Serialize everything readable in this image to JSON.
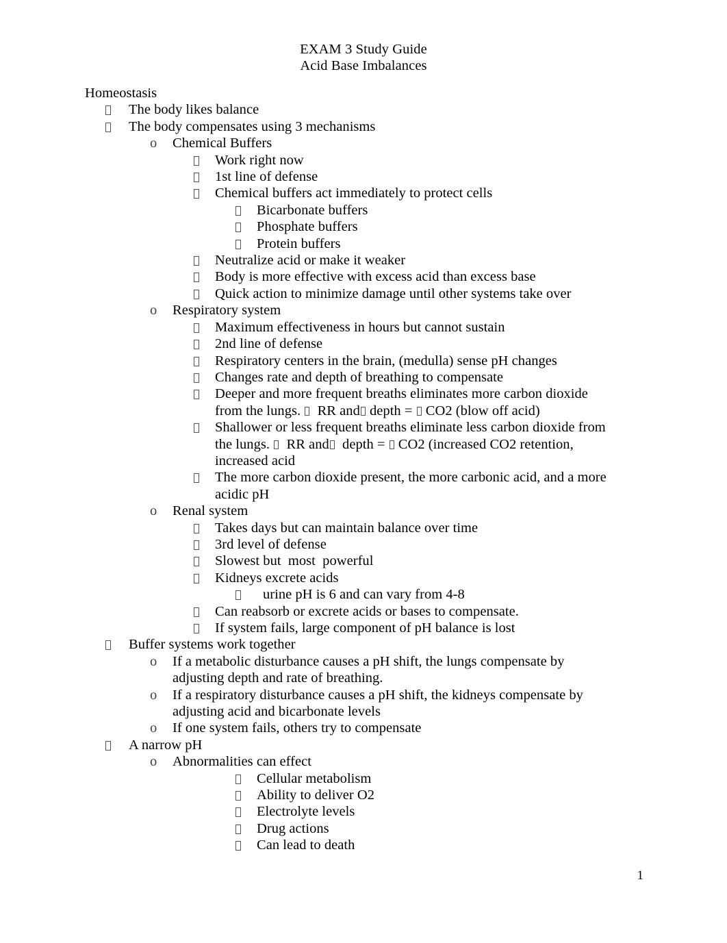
{
  "document": {
    "title_line_1": "EXAM 3 Study Guide",
    "title_line_2": "Acid Base Imbalances",
    "page_number": "1"
  },
  "outline": [
    {
      "level": 0,
      "marker": "none",
      "text": "Homeostasis"
    },
    {
      "level": 1,
      "marker": "tofu",
      "text": "The body likes balance"
    },
    {
      "level": 1,
      "marker": "tofu",
      "text": "The body compensates using 3 mechanisms"
    },
    {
      "level": 2,
      "marker": "o",
      "text": "Chemical Buffers"
    },
    {
      "level": 3,
      "marker": "tofu",
      "text": "Work right now"
    },
    {
      "level": 3,
      "marker": "tofu",
      "text": "1st line of defense"
    },
    {
      "level": 3,
      "marker": "tofu",
      "text": "Chemical buffers act immediately to protect cells"
    },
    {
      "level": 4,
      "marker": "tofu",
      "text": "Bicarbonate buffers"
    },
    {
      "level": 4,
      "marker": "tofu",
      "text": "Phosphate buffers"
    },
    {
      "level": 4,
      "marker": "tofu",
      "text": "Protein buffers"
    },
    {
      "level": 3,
      "marker": "tofu",
      "text": "Neutralize acid or make it weaker"
    },
    {
      "level": 3,
      "marker": "tofu",
      "text": "Body is more effective with excess acid than excess base"
    },
    {
      "level": 3,
      "marker": "tofu",
      "text": "Quick action to minimize damage until other systems take over"
    },
    {
      "level": 2,
      "marker": "o",
      "text": "Respiratory system"
    },
    {
      "level": 3,
      "marker": "tofu",
      "text": "Maximum effectiveness in hours but cannot sustain"
    },
    {
      "level": 3,
      "marker": "tofu",
      "text": "2nd line of defense"
    },
    {
      "level": 3,
      "marker": "tofu",
      "text": "Respiratory centers in the brain, (medulla) sense pH changes"
    },
    {
      "level": 3,
      "marker": "tofu",
      "text": "Changes rate and depth of breathing to compensate"
    },
    {
      "level": 3,
      "marker": "tofu",
      "segments": [
        {
          "type": "text",
          "value": "Deeper and more frequent breaths eliminates more carbon dioxide from the lungs. "
        },
        {
          "type": "glyph",
          "value": "tofu"
        },
        {
          "type": "text",
          "value": "  RR and"
        },
        {
          "type": "glyph",
          "value": "tofu"
        },
        {
          "type": "text",
          "value": " depth = "
        },
        {
          "type": "glyph",
          "value": "tofu"
        },
        {
          "type": "text",
          "value": " CO2 (blow off acid)"
        }
      ]
    },
    {
      "level": 3,
      "marker": "tofu",
      "segments": [
        {
          "type": "text",
          "value": "Shallower or less frequent breaths eliminate less carbon dioxide from the lungs. "
        },
        {
          "type": "glyph",
          "value": "tofu"
        },
        {
          "type": "text",
          "value": "  RR and"
        },
        {
          "type": "glyph",
          "value": "tofu"
        },
        {
          "type": "text",
          "value": "  depth = "
        },
        {
          "type": "glyph",
          "value": "tofu"
        },
        {
          "type": "text",
          "value": " CO2 (increased CO2 retention, increased acid"
        }
      ]
    },
    {
      "level": 3,
      "marker": "tofu",
      "text": "The more carbon dioxide present, the more carbonic acid, and a more acidic pH"
    },
    {
      "level": 2,
      "marker": "o",
      "text": "Renal system"
    },
    {
      "level": 3,
      "marker": "tofu",
      "text": "Takes days but can maintain balance over time"
    },
    {
      "level": 3,
      "marker": "tofu",
      "text": "3rd level of defense"
    },
    {
      "level": 3,
      "marker": "tofu",
      "text": "Slowest but  most  powerful"
    },
    {
      "level": 3,
      "marker": "tofu",
      "text": "Kidneys excrete acids"
    },
    {
      "level": 4,
      "marker": "tofu",
      "wide": true,
      "text": "urine pH is 6 and can vary from 4-8"
    },
    {
      "level": 3,
      "marker": "tofu",
      "text": "Can reabsorb or excrete acids or bases to compensate."
    },
    {
      "level": 3,
      "marker": "tofu",
      "text": "If system fails, large component of pH balance is lost"
    },
    {
      "level": 1,
      "marker": "tofu",
      "text": "Buffer systems work together"
    },
    {
      "level": 2,
      "marker": "o",
      "text": "If a metabolic disturbance causes a pH shift, the lungs compensate by adjusting depth and rate of breathing."
    },
    {
      "level": 2,
      "marker": "o",
      "text": "If a respiratory disturbance causes a pH shift, the kidneys compensate by adjusting acid and bicarbonate levels"
    },
    {
      "level": 2,
      "marker": "o",
      "text": "If one system fails, others try to compensate"
    },
    {
      "level": 1,
      "marker": "tofu",
      "text": "A narrow pH"
    },
    {
      "level": 2,
      "marker": "o",
      "text": "Abnormalities can effect"
    },
    {
      "level": 4,
      "marker": "tofu",
      "text": "Cellular metabolism"
    },
    {
      "level": 4,
      "marker": "tofu",
      "text": "Ability to deliver O2"
    },
    {
      "level": 4,
      "marker": "tofu",
      "text": "Electrolyte levels"
    },
    {
      "level": 4,
      "marker": "tofu",
      "text": "Drug actions"
    },
    {
      "level": 4,
      "marker": "tofu",
      "text": "Can lead to death"
    }
  ]
}
